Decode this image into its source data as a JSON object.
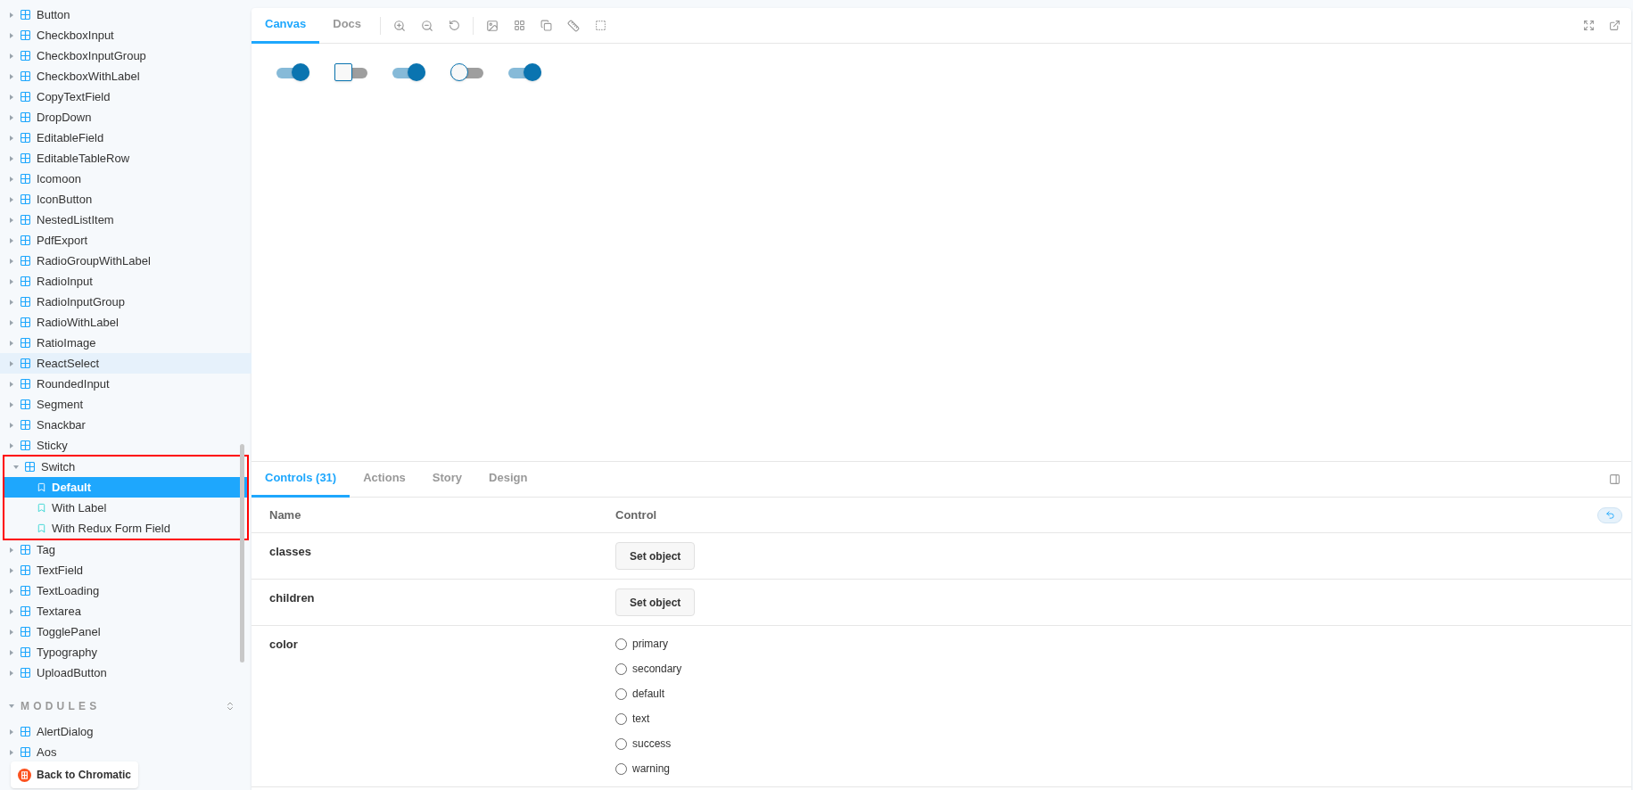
{
  "sidebar": {
    "groups": [
      {
        "kind": "plain",
        "items": [
          {
            "label": "Button",
            "expanded": false,
            "hovered": false,
            "annotated": false
          },
          {
            "label": "CheckboxInput",
            "expanded": false,
            "hovered": false,
            "annotated": false
          },
          {
            "label": "CheckboxInputGroup",
            "expanded": false,
            "hovered": false,
            "annotated": false
          },
          {
            "label": "CheckboxWithLabel",
            "expanded": false,
            "hovered": false,
            "annotated": false
          },
          {
            "label": "CopyTextField",
            "expanded": false,
            "hovered": false,
            "annotated": false
          },
          {
            "label": "DropDown",
            "expanded": false,
            "hovered": false,
            "annotated": false
          },
          {
            "label": "EditableField",
            "expanded": false,
            "hovered": false,
            "annotated": false
          },
          {
            "label": "EditableTableRow",
            "expanded": false,
            "hovered": false,
            "annotated": false
          },
          {
            "label": "Icomoon",
            "expanded": false,
            "hovered": false,
            "annotated": false
          },
          {
            "label": "IconButton",
            "expanded": false,
            "hovered": false,
            "annotated": false
          },
          {
            "label": "NestedListItem",
            "expanded": false,
            "hovered": false,
            "annotated": false
          },
          {
            "label": "PdfExport",
            "expanded": false,
            "hovered": false,
            "annotated": false
          },
          {
            "label": "RadioGroupWithLabel",
            "expanded": false,
            "hovered": false,
            "annotated": false
          },
          {
            "label": "RadioInput",
            "expanded": false,
            "hovered": false,
            "annotated": false
          },
          {
            "label": "RadioInputGroup",
            "expanded": false,
            "hovered": false,
            "annotated": false
          },
          {
            "label": "RadioWithLabel",
            "expanded": false,
            "hovered": false,
            "annotated": false
          },
          {
            "label": "RatioImage",
            "expanded": false,
            "hovered": false,
            "annotated": false
          },
          {
            "label": "ReactSelect",
            "expanded": false,
            "hovered": true,
            "annotated": false
          },
          {
            "label": "RoundedInput",
            "expanded": false,
            "hovered": false,
            "annotated": false
          },
          {
            "label": "Segment",
            "expanded": false,
            "hovered": false,
            "annotated": false
          },
          {
            "label": "Snackbar",
            "expanded": false,
            "hovered": false,
            "annotated": false
          },
          {
            "label": "Sticky",
            "expanded": false,
            "hovered": false,
            "annotated": false
          },
          {
            "label": "Switch",
            "expanded": true,
            "hovered": false,
            "annotated": true,
            "children": [
              {
                "label": "Default",
                "selected": true
              },
              {
                "label": "With Label",
                "selected": false
              },
              {
                "label": "With Redux Form Field",
                "selected": false
              }
            ]
          },
          {
            "label": "Tag",
            "expanded": false,
            "hovered": false,
            "annotated": false
          },
          {
            "label": "TextField",
            "expanded": false,
            "hovered": false,
            "annotated": false
          },
          {
            "label": "TextLoading",
            "expanded": false,
            "hovered": false,
            "annotated": false
          },
          {
            "label": "Textarea",
            "expanded": false,
            "hovered": false,
            "annotated": false
          },
          {
            "label": "TogglePanel",
            "expanded": false,
            "hovered": false,
            "annotated": false
          },
          {
            "label": "Typography",
            "expanded": false,
            "hovered": false,
            "annotated": false
          },
          {
            "label": "UploadButton",
            "expanded": false,
            "hovered": false,
            "annotated": false
          }
        ]
      },
      {
        "kind": "titled",
        "title": "MODULES",
        "items": [
          {
            "label": "AlertDialog",
            "expanded": false,
            "hovered": false,
            "annotated": false
          },
          {
            "label": "Aos",
            "expanded": false,
            "hovered": false,
            "annotated": false
          }
        ]
      }
    ],
    "chromatic_button": "Back to Chromatic"
  },
  "toolbar": {
    "tabs": [
      {
        "label": "Canvas",
        "selected": true
      },
      {
        "label": "Docs",
        "selected": false
      }
    ]
  },
  "canvas": {
    "switches": [
      {
        "kind": "round",
        "checked": true
      },
      {
        "kind": "square",
        "checked": false
      },
      {
        "kind": "round",
        "checked": true
      },
      {
        "kind": "round",
        "checked": false
      },
      {
        "kind": "round",
        "checked": true
      }
    ]
  },
  "addons": {
    "tabs": [
      {
        "label": "Controls (31)",
        "selected": true
      },
      {
        "label": "Actions",
        "selected": false
      },
      {
        "label": "Story",
        "selected": false
      },
      {
        "label": "Design",
        "selected": false
      }
    ],
    "table": {
      "columns": [
        "Name",
        "Control"
      ],
      "rows": [
        {
          "name": "classes",
          "kind": "object",
          "button": "Set object"
        },
        {
          "name": "children",
          "kind": "object",
          "button": "Set object"
        },
        {
          "name": "color",
          "kind": "radio",
          "options": [
            {
              "label": "primary",
              "selected": false
            },
            {
              "label": "secondary",
              "selected": false
            },
            {
              "label": "default",
              "selected": false
            },
            {
              "label": "text",
              "selected": false
            },
            {
              "label": "success",
              "selected": false
            },
            {
              "label": "warning",
              "selected": false
            }
          ]
        }
      ]
    }
  }
}
